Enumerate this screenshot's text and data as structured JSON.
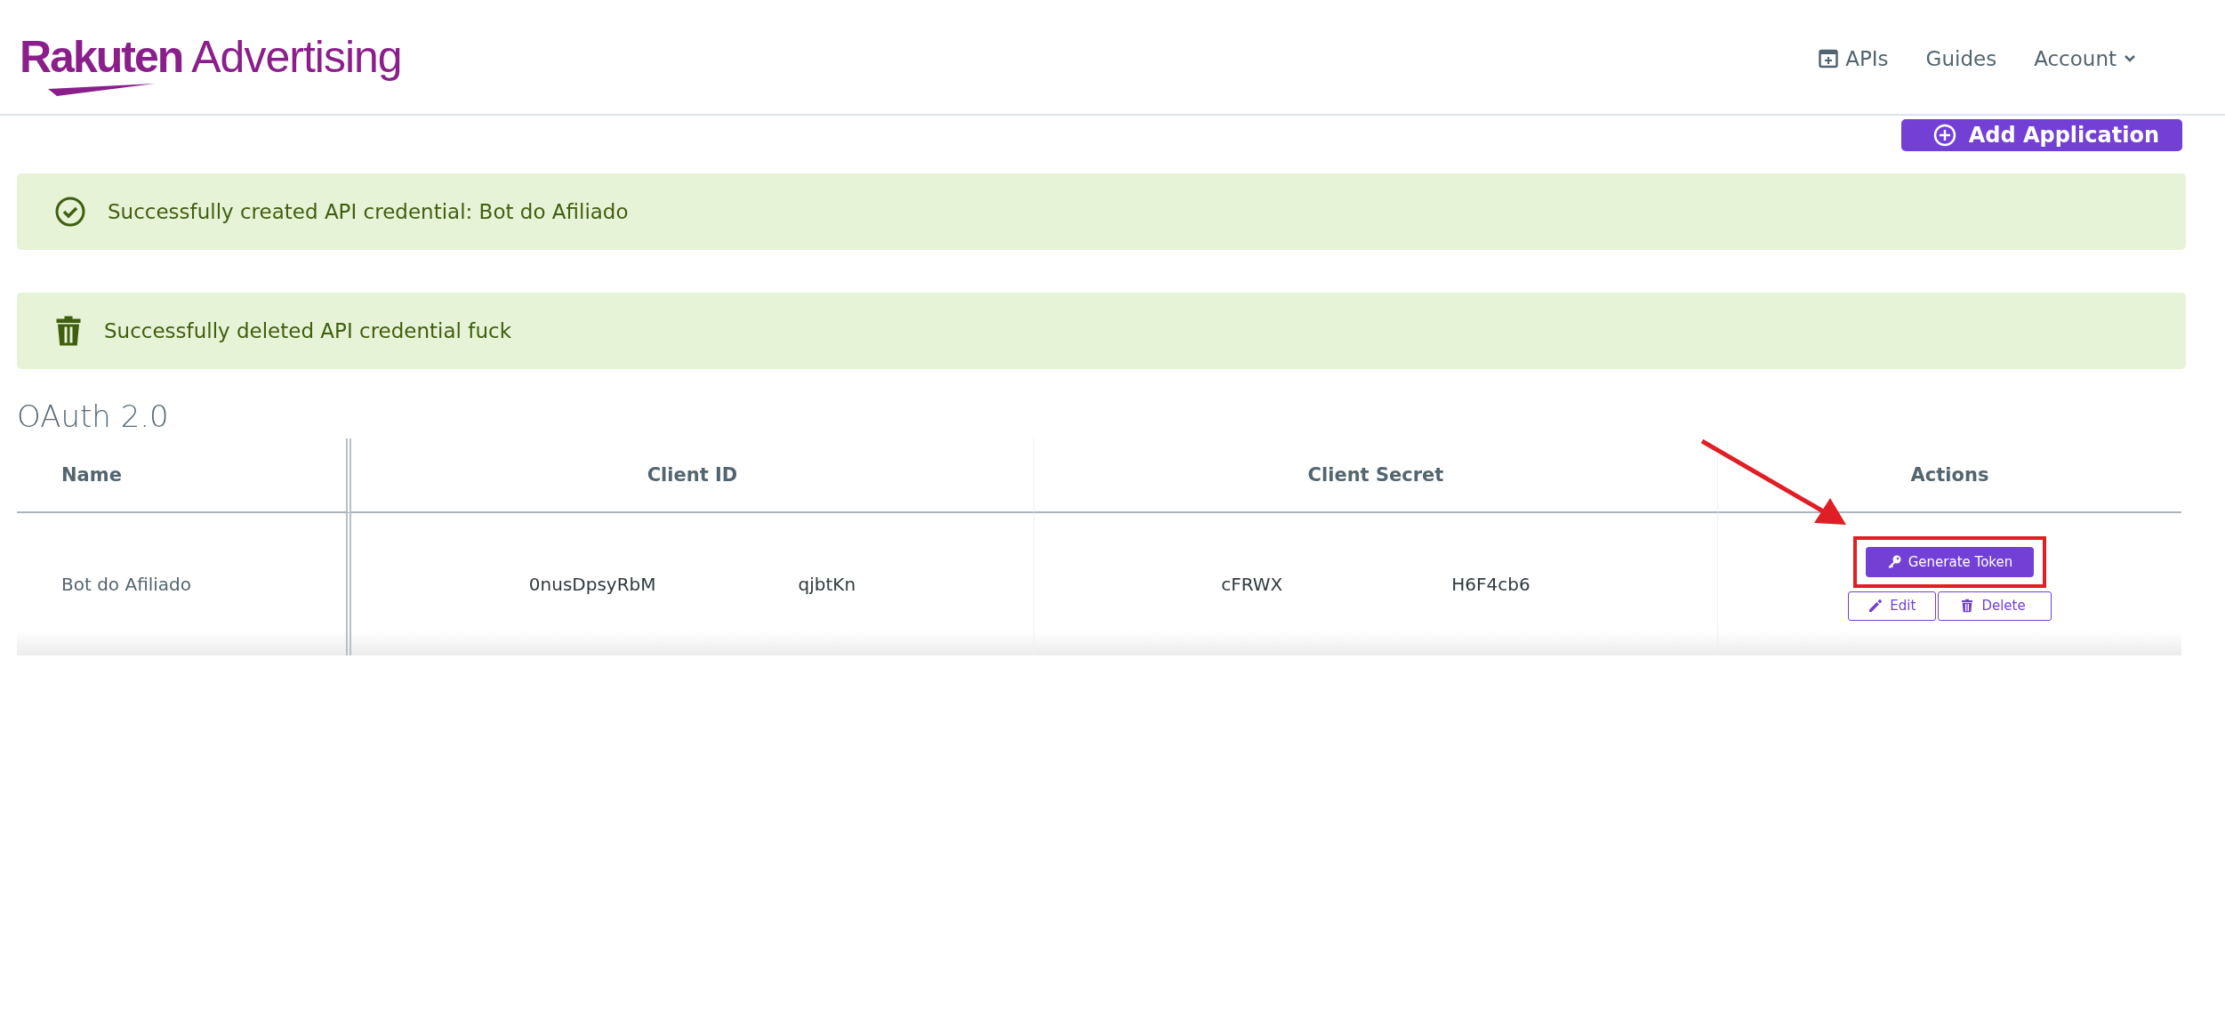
{
  "header": {
    "logo": {
      "brand": "Rakuten",
      "product": "Advertising"
    },
    "nav": [
      {
        "kind": "apis",
        "label": "APIs"
      },
      {
        "kind": "plain",
        "label": "Guides"
      },
      {
        "kind": "dropdown",
        "label": "Account"
      }
    ]
  },
  "page": {
    "add_button": "Add Application"
  },
  "alerts": [
    {
      "kind": "created",
      "text": "Successfully created API credential: Bot do Afiliado"
    },
    {
      "kind": "deleted",
      "text": "Successfully deleted API credential fuck"
    }
  ],
  "section": {
    "title": "OAuth 2.0"
  },
  "table": {
    "columns": [
      "Name",
      "Client ID",
      "Client Secret",
      "Actions"
    ],
    "rows": [
      {
        "name": "Bot do Afiliado",
        "client_id": [
          "0nusDpsyRbM",
          "qjbtKn"
        ],
        "client_secret": [
          "cFRWX",
          "H6F4cb6"
        ],
        "actions": [
          {
            "kind": "generate",
            "label": "Generate Token",
            "highlighted": true
          },
          {
            "kind": "edit",
            "label": "Edit"
          },
          {
            "kind": "delete",
            "label": "Delete"
          }
        ]
      }
    ]
  }
}
